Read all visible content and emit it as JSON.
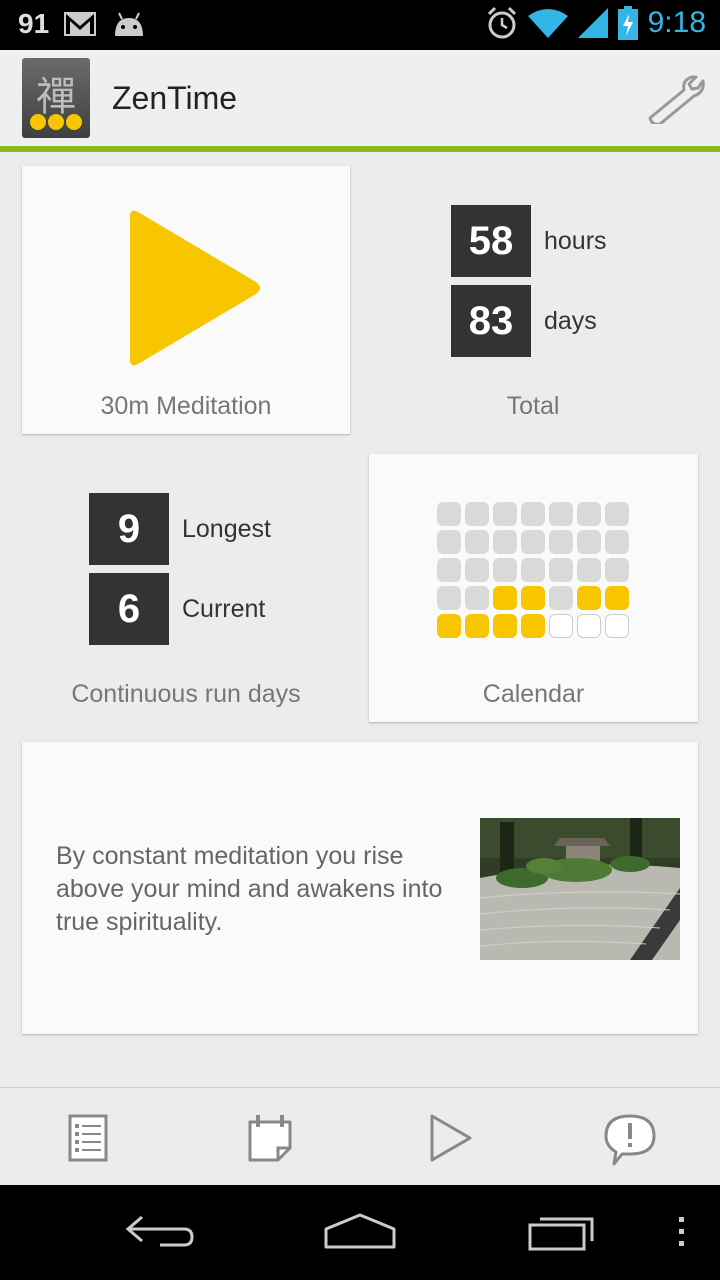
{
  "status_bar": {
    "battery_level": "91",
    "time": "9:18",
    "icons": [
      "gmail-icon",
      "android-icon",
      "alarm-icon",
      "wifi-icon",
      "signal-icon",
      "battery-icon"
    ]
  },
  "app": {
    "title": "ZenTime",
    "logo_glyph": "禪",
    "settings_icon": "wrench-icon"
  },
  "meditation_card": {
    "label": "30m Meditation",
    "icon": "play-icon",
    "play_color": "#f7c600"
  },
  "totals": {
    "hours_value": "58",
    "hours_label": "hours",
    "days_value": "83",
    "days_label": "days",
    "caption": "Total"
  },
  "run_days": {
    "longest_value": "9",
    "longest_label": "Longest",
    "current_value": "6",
    "current_label": "Current",
    "caption": "Continuous run days"
  },
  "calendar": {
    "caption": "Calendar",
    "rows": [
      [
        "off",
        "off",
        "off",
        "off",
        "off",
        "off",
        "off"
      ],
      [
        "off",
        "off",
        "off",
        "off",
        "off",
        "off",
        "off"
      ],
      [
        "off",
        "off",
        "off",
        "off",
        "off",
        "off",
        "off"
      ],
      [
        "off",
        "off",
        "on",
        "on",
        "off",
        "on",
        "on"
      ],
      [
        "on",
        "on",
        "on",
        "on",
        "empty",
        "empty",
        "empty"
      ]
    ]
  },
  "quote": {
    "text": "By constant meditation you rise above your mind and awakens into true spirituality.",
    "image": "zen-garden-photo"
  },
  "bottom_tabs": [
    {
      "name": "history-tab",
      "icon": "list-icon"
    },
    {
      "name": "calendar-tab",
      "icon": "calendar-icon"
    },
    {
      "name": "play-tab",
      "icon": "play-icon"
    },
    {
      "name": "feedback-tab",
      "icon": "speech-bubble-icon"
    }
  ],
  "nav_bar": [
    "back-icon",
    "home-icon",
    "recents-icon",
    "menu-icon"
  ],
  "colors": {
    "accent_green": "#8bbb1b",
    "accent_yellow": "#f7c600",
    "clock_blue": "#33b5e5"
  }
}
